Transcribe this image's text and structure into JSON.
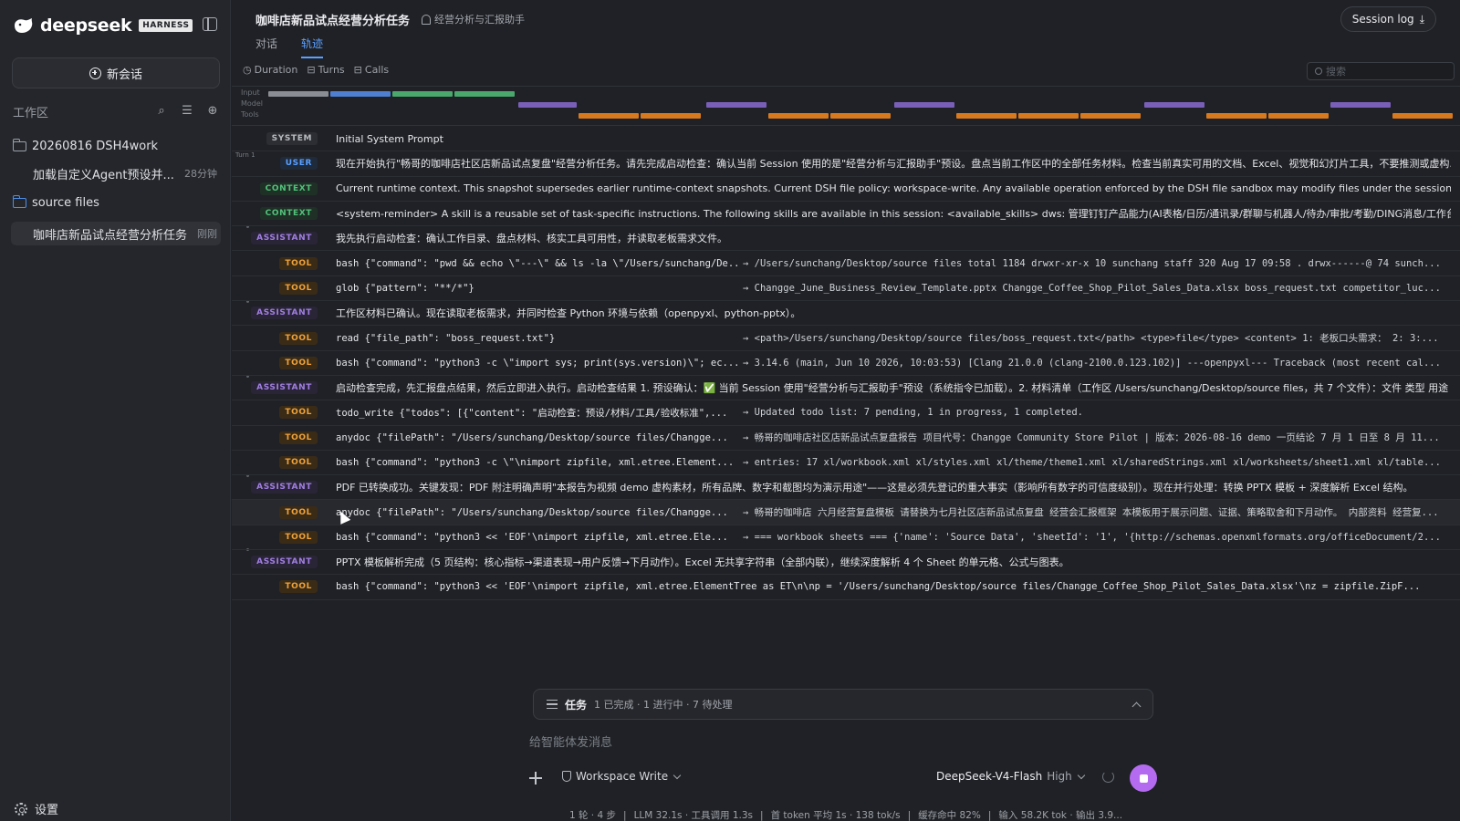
{
  "sidebar": {
    "brand_name": "deepseek",
    "brand_badge": "HARNESS",
    "new_chat_label": "新会话",
    "workspace_label": "工作区",
    "tree": [
      {
        "label": "20260816 DSH4work"
      },
      {
        "label": "加载自定义Agent预设并...",
        "time": "28分钟"
      },
      {
        "label": "source files"
      },
      {
        "label": "咖啡店新品试点经营分析任务",
        "time": "刚刚"
      }
    ],
    "settings_label": "设置"
  },
  "header": {
    "title": "咖啡店新品试点经营分析任务",
    "assistant": "经营分析与汇报助手",
    "tabs": [
      {
        "label": "对话"
      },
      {
        "label": "轨迹"
      }
    ],
    "active_tab": "轨迹",
    "session_log_label": "Session log"
  },
  "metrics": {
    "duration": "Duration",
    "turns": "Turns",
    "calls": "Calls"
  },
  "search": {
    "placeholder": "搜索"
  },
  "timeline": {
    "labels": [
      "Input",
      "Model",
      "Tools"
    ],
    "turn_label": "Turn 1"
  },
  "log": [
    {
      "role": "SYSTEM",
      "kind": "system",
      "text": "Initial System Prompt"
    },
    {
      "role": "USER",
      "kind": "user",
      "text": "现在开始执行\"畅哥的咖啡店社区店新品试点复盘\"经营分析任务。请先完成启动检查：确认当前 Session 使用的是\"经营分析与汇报助手\"预设。盘点当前工作区中的全部任务材料。检查当前真实可用的文档、Excel、视觉和幻灯片工具，不要推测或虚构..."
    },
    {
      "role": "CONTEXT",
      "kind": "context",
      "text": "Current runtime context. This snapshot supersedes earlier runtime-context snapshots. Current DSH file policy: workspace-write. Any available operation enforced by the DSH file sandbox may modify files under the session workspace: \"/..."
    },
    {
      "role": "CONTEXT",
      "kind": "context",
      "text": "<system-reminder> A skill is a reusable set of task-specific instructions. The following skills are available in this session: <available_skills> dws: 管理钉钉产品能力(AI表格/日历/通讯录/群聊与机器人/待办/审批/考勤/DING消息/工作台/开放..."
    },
    {
      "role": "ASSISTANT",
      "kind": "assistant",
      "text": "我先执行启动检查：确认工作目录、盘点材料、核实工具可用性，并读取老板需求文件。"
    },
    {
      "role": "TOOL",
      "kind": "tool",
      "call": "bash {\"command\": \"pwd && echo \\\"---\\\" && ls -la \\\"/Users/sunchang/De...",
      "result": "→ /Users/sunchang/Desktop/source files total 1184 drwxr-xr-x 10 sunchang staff 320 Aug 17 09:58 . drwx------@ 74 sunch..."
    },
    {
      "role": "TOOL",
      "kind": "tool",
      "call": "glob {\"pattern\": \"**/*\"}",
      "result": "→ Changge_June_Business_Review_Template.pptx Changge_Coffee_Shop_Pilot_Sales_Data.xlsx boss_request.txt competitor_luc..."
    },
    {
      "role": "ASSISTANT",
      "kind": "assistant",
      "text": "工作区材料已确认。现在读取老板需求，并同时检查 Python 环境与依赖（openpyxl、python-pptx）。"
    },
    {
      "role": "TOOL",
      "kind": "tool",
      "call": "read {\"file_path\": \"boss_request.txt\"}",
      "result": "→ <path>/Users/sunchang/Desktop/source files/boss_request.txt</path> <type>file</type> <content> 1: 老板口头需求： 2: 3:..."
    },
    {
      "role": "TOOL",
      "kind": "tool",
      "call": "bash {\"command\": \"python3 -c \\\"import sys; print(sys.version)\\\"; ec...",
      "result": "→ 3.14.6 (main, Jun 10 2026, 10:03:53) [Clang 21.0.0 (clang-2100.0.123.102)] ---openpyxl--- Traceback (most recent cal..."
    },
    {
      "role": "ASSISTANT",
      "kind": "assistant",
      "text": "启动检查完成，先汇报盘点结果，然后立即进入执行。启动检查结果 1. 预设确认：✅ 当前 Session 使用\"经营分析与汇报助手\"预设（系统指令已加载）。2. 材料清单（工作区 /Users/sunchang/Desktop/source files，共 7 个文件）：文件 类型 用途 Ch..."
    },
    {
      "role": "TOOL",
      "kind": "tool",
      "call": "todo_write {\"todos\": [{\"content\": \"启动检查：预设/材料/工具/验收标准\",...",
      "result": "→ Updated todo list: 7 pending, 1 in progress, 1 completed."
    },
    {
      "role": "TOOL",
      "kind": "tool",
      "call": "anydoc {\"filePath\": \"/Users/sunchang/Desktop/source files/Changge...",
      "result": "→ 畅哥的咖啡店社区店新品试点复盘报告 项目代号：Changge Community Store Pilot | 版本：2026-08-16 demo 一页结论 7 月 1 日至 8 月 11..."
    },
    {
      "role": "TOOL",
      "kind": "tool",
      "call": "bash {\"command\": \"python3 -c \\\"\\nimport zipfile, xml.etree.Element...",
      "result": "→ entries: 17 xl/workbook.xml xl/styles.xml xl/theme/theme1.xml xl/sharedStrings.xml xl/worksheets/sheet1.xml xl/table..."
    },
    {
      "role": "ASSISTANT",
      "kind": "assistant",
      "text": "PDF 已转换成功。关键发现：PDF 附注明确声明\"本报告为视频 demo 虚构素材，所有品牌、数字和截图均为演示用途\"——这是必须先登记的重大事实（影响所有数字的可信度级别）。现在并行处理：转换 PPTX 模板 + 深度解析 Excel 结构。"
    },
    {
      "role": "TOOL",
      "kind": "tool",
      "hl": true,
      "call": "anydoc {\"filePath\": \"/Users/sunchang/Desktop/source files/Changge...",
      "result": "→ 畅哥的咖啡店 六月经营复盘模板 请替换为七月社区店新品试点复盘 经营会汇报框架 本模板用于展示问题、证据、策略取舍和下月动作。 内部资料 经营复..."
    },
    {
      "role": "TOOL",
      "kind": "tool",
      "call": "bash {\"command\": \"python3 << 'EOF'\\nimport zipfile, xml.etree.Ele...",
      "result": "→ === workbook sheets === {'name': 'Source Data', 'sheetId': '1', '{http://schemas.openxmlformats.org/officeDocument/2..."
    },
    {
      "role": "ASSISTANT",
      "kind": "assistant",
      "text": "PPTX 模板解析完成（5 页结构：核心指标→渠道表现→用户反馈→下月动作）。Excel 无共享字符串（全部内联），继续深度解析 4 个 Sheet 的单元格、公式与图表。"
    },
    {
      "role": "TOOL",
      "kind": "tool",
      "call": "bash {\"command\": \"python3 << 'EOF'\\nimport zipfile, xml.etree.ElementTree as ET\\n\\np = '/Users/sunchang/Desktop/source files/Changge_Coffee_Shop_Pilot_Sales_Data.xlsx'\\nz = zipfile.ZipF...",
      "result": ""
    }
  ],
  "task_panel": {
    "title": "任务",
    "stats": "1 已完成 · 1 进行中 · 7 待处理"
  },
  "composer": {
    "placeholder": "给智能体发消息",
    "mode": "Workspace Write",
    "model": "DeepSeek-V4-Flash",
    "effort": "High"
  },
  "status_bar": [
    "1 轮 · 4 步",
    "|",
    "LLM 32.1s · 工具调用 1.3s",
    "|",
    "首 token 平均 1s · 138 tok/s",
    "|",
    "缓存命中 82%",
    "|",
    "输入 58.2K tok · 输出 3.9..."
  ],
  "colors": {
    "accent": "#5aa0ff",
    "user": "#5aa0ff",
    "context": "#52c27b",
    "assistant": "#a07fe0",
    "tool": "#f0a33a",
    "stop": "#b56bf0"
  }
}
